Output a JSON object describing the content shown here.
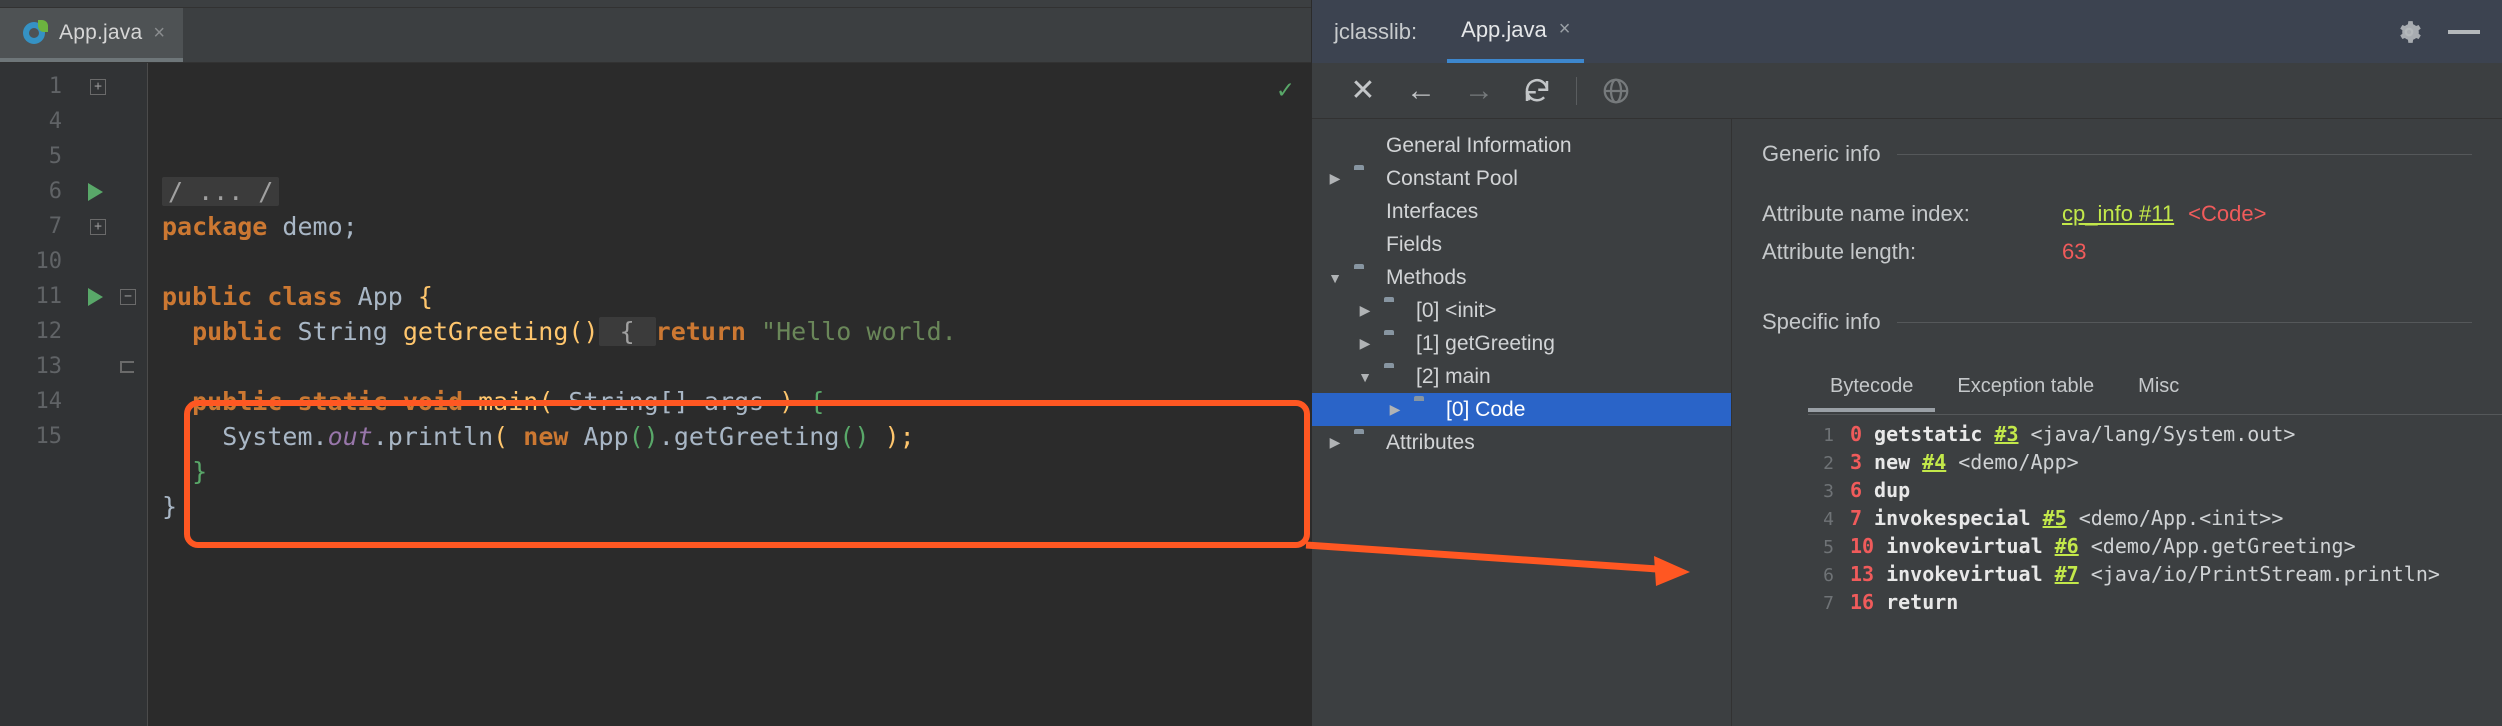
{
  "editor": {
    "tab": {
      "title": "App.java",
      "close_label": "×",
      "icon": "java-class-icon"
    },
    "status_check": "✓",
    "lines": [
      {
        "num": "1",
        "mark": "fold-plus",
        "segments": [
          {
            "t": "/ ... /",
            "c": "fold-chip"
          }
        ]
      },
      {
        "num": "4",
        "mark": "",
        "segments": [
          {
            "t": "package",
            "c": "kw"
          },
          {
            "t": " demo;",
            "c": "plain"
          }
        ]
      },
      {
        "num": "5",
        "mark": "",
        "segments": []
      },
      {
        "num": "6",
        "mark": "run",
        "segments": [
          {
            "t": "public class",
            "c": "kw"
          },
          {
            "t": " App ",
            "c": "typ"
          },
          {
            "t": "{",
            "c": "brace"
          }
        ]
      },
      {
        "num": "7",
        "mark": "fold-plus",
        "segments": [
          {
            "t": "  public",
            "c": "kw"
          },
          {
            "t": " String ",
            "c": "typ"
          },
          {
            "t": "getGreeting()",
            "c": "mth"
          },
          {
            "t": " { ",
            "c": "fold-chip"
          },
          {
            "t": "return",
            "c": "kw"
          },
          {
            "t": " \"Hello world.",
            "c": "str"
          }
        ]
      },
      {
        "num": "10",
        "mark": "",
        "segments": []
      },
      {
        "num": "11",
        "mark": "run-minus",
        "segments": [
          {
            "t": "  public static void",
            "c": "kw"
          },
          {
            "t": " ",
            "c": "plain"
          },
          {
            "t": "main",
            "c": "mth"
          },
          {
            "t": "(",
            "c": "brace"
          },
          {
            "t": " String[] args ",
            "c": "typ"
          },
          {
            "t": ")",
            "c": "brace"
          },
          {
            "t": " ",
            "c": "plain"
          },
          {
            "t": "{",
            "c": "brace-g"
          }
        ]
      },
      {
        "num": "12",
        "mark": "",
        "segments": [
          {
            "t": "    System.",
            "c": "plain"
          },
          {
            "t": "out",
            "c": "stat"
          },
          {
            "t": ".println",
            "c": "plain"
          },
          {
            "t": "(",
            "c": "brace"
          },
          {
            "t": " ",
            "c": "plain"
          },
          {
            "t": "new",
            "c": "kw"
          },
          {
            "t": " App",
            "c": "plain"
          },
          {
            "t": "()",
            "c": "brace-g"
          },
          {
            "t": ".getGreeting",
            "c": "plain"
          },
          {
            "t": "()",
            "c": "brace-g"
          },
          {
            "t": " ",
            "c": "plain"
          },
          {
            "t": ")",
            "c": "brace"
          },
          {
            "t": ";",
            "c": "brace"
          }
        ]
      },
      {
        "num": "13",
        "mark": "fold-end",
        "segments": [
          {
            "t": "  }",
            "c": "brace-g"
          }
        ]
      },
      {
        "num": "14",
        "mark": "",
        "segments": [
          {
            "t": "}",
            "c": "plain"
          }
        ]
      },
      {
        "num": "15",
        "mark": "",
        "segments": []
      }
    ]
  },
  "tool": {
    "label": "jclasslib:",
    "tab": {
      "title": "App.java",
      "close_label": "×"
    },
    "header_icons": [
      {
        "name": "gear-icon"
      },
      {
        "name": "minimize-icon"
      }
    ],
    "toolbar": [
      {
        "name": "close-icon",
        "glyph": "✕",
        "enabled": true
      },
      {
        "name": "back-arrow-icon",
        "glyph": "←",
        "enabled": true
      },
      {
        "name": "forward-arrow-icon",
        "glyph": "→",
        "enabled": false
      },
      {
        "name": "reload-icon",
        "glyph": "↻",
        "enabled": true
      },
      {
        "name": "browse-web-icon",
        "glyph": "●",
        "enabled": false
      }
    ],
    "tree": [
      {
        "label": "General Information",
        "indent": 0,
        "twist": "",
        "icon": "file-icon",
        "selected": false
      },
      {
        "label": "Constant Pool",
        "indent": 0,
        "twist": "▶",
        "icon": "folder-icon",
        "selected": false
      },
      {
        "label": "Interfaces",
        "indent": 0,
        "twist": "",
        "icon": "file-icon",
        "selected": false
      },
      {
        "label": "Fields",
        "indent": 0,
        "twist": "",
        "icon": "file-icon",
        "selected": false
      },
      {
        "label": "Methods",
        "indent": 0,
        "twist": "▼",
        "icon": "folder-icon",
        "selected": false
      },
      {
        "label": "[0] <init>",
        "indent": 1,
        "twist": "▶",
        "icon": "folder-icon",
        "selected": false
      },
      {
        "label": "[1] getGreeting",
        "indent": 1,
        "twist": "▶",
        "icon": "folder-icon",
        "selected": false
      },
      {
        "label": "[2] main",
        "indent": 1,
        "twist": "▼",
        "icon": "folder-icon",
        "selected": false
      },
      {
        "label": "[0] Code",
        "indent": 2,
        "twist": "▶",
        "icon": "folder-icon",
        "selected": true
      },
      {
        "label": "Attributes",
        "indent": 0,
        "twist": "▶",
        "icon": "folder-icon",
        "selected": false
      }
    ],
    "generic_info": {
      "title": "Generic info",
      "rows": [
        {
          "key": "Attribute name index:",
          "link": "cp_info #11",
          "value": "<Code>"
        },
        {
          "key": "Attribute length:",
          "link": "",
          "value": "63"
        }
      ]
    },
    "specific_info": {
      "title": "Specific info"
    },
    "subtabs": [
      {
        "label": "Bytecode",
        "active": true
      },
      {
        "label": "Exception table",
        "active": false
      },
      {
        "label": "Misc",
        "active": false
      }
    ],
    "bytecode": [
      {
        "n": "1",
        "offset": "0",
        "op": "getstatic",
        "ref": "#3",
        "comment": "<java/lang/System.out>"
      },
      {
        "n": "2",
        "offset": "3",
        "op": "new",
        "ref": "#4",
        "comment": "<demo/App>"
      },
      {
        "n": "3",
        "offset": "6",
        "op": "dup",
        "ref": "",
        "comment": ""
      },
      {
        "n": "4",
        "offset": "7",
        "op": "invokespecial",
        "ref": "#5",
        "comment": "<demo/App.<init>>"
      },
      {
        "n": "5",
        "offset": "10",
        "op": "invokevirtual",
        "ref": "#6",
        "comment": "<demo/App.getGreeting>"
      },
      {
        "n": "6",
        "offset": "13",
        "op": "invokevirtual",
        "ref": "#7",
        "comment": "<java/io/PrintStream.println>"
      },
      {
        "n": "7",
        "offset": "16",
        "op": "return",
        "ref": "",
        "comment": ""
      }
    ]
  },
  "annotation": {
    "highlight_color": "#ff5722",
    "shape": "rounded-rectangle-with-arrow"
  }
}
